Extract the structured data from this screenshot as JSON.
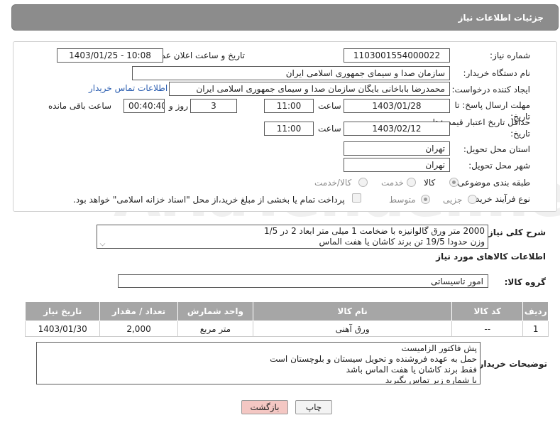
{
  "header": {
    "title": "جزئیات اطلاعات نیاز"
  },
  "form": {
    "need_number_label": "شماره نیاز:",
    "need_number": "1103001554000022",
    "announce_label": "تاریخ و ساعت اعلان عمومی:",
    "announce_value": "1403/01/25 - 10:08",
    "buyer_org_label": "نام دستگاه خریدار:",
    "buyer_org": "سازمان صدا و سیمای جمهوری اسلامی ایران",
    "creator_label": "ایجاد کننده درخواست:",
    "creator": "محمدرضا  باباخانی بایگان سازمان صدا و سیمای جمهوری اسلامی ایران",
    "contact_link": "اطلاعات تماس خریدار",
    "deadline_label": "مهلت ارسال پاسخ: تا تاریخ:",
    "deadline_date": "1403/01/28",
    "time_label": "ساعت",
    "deadline_time": "11:00",
    "days_value": "3",
    "days_label": "روز و",
    "remaining_value": "00:40:40",
    "remaining_label": "ساعت باقی مانده",
    "validity_label": "حداقل تاریخ اعتبار قیمت: تا تاریخ:",
    "validity_date": "1403/02/12",
    "validity_time": "11:00",
    "province_label": "استان محل تحویل:",
    "province": "تهران",
    "city_label": "شهر محل تحویل:",
    "city": "تهران",
    "category_label": "طبقه بندی موضوعی:",
    "category_options": [
      "کالا",
      "خدمت",
      "کالا/خدمت"
    ],
    "process_label": "نوع فرآیند خرید :",
    "process_options": [
      "جزیی",
      "متوسط"
    ],
    "payment_text": "پرداخت تمام یا بخشی از مبلغ خرید،از محل \"اسناد خزانه اسلامی\" خواهد بود."
  },
  "description": {
    "label": "شرح کلی نیاز:",
    "line1": "2000 متر ورق گالوانیزه با ضخامت 1 میلی متر ابعاد 2 در 1/5",
    "line2": "وزن حدودا 19/5 تن برند کاشان یا هفت الماس"
  },
  "goods": {
    "section_title": "اطلاعات کالاهای مورد نیاز",
    "group_label": "گروه کالا:",
    "group_value": "امور تاسیساتی",
    "columns": [
      "ردیف",
      "کد کالا",
      "نام کالا",
      "واحد شمارش",
      "تعداد / مقدار",
      "تاریخ نیاز"
    ],
    "rows": [
      {
        "index": "1",
        "code": "--",
        "name": "ورق آهنی",
        "unit": "متر مربع",
        "qty": "2,000",
        "date": "1403/01/30"
      }
    ]
  },
  "buyer_notes": {
    "label": "توضیحات خریدار:",
    "lines": [
      "پش فاکتور الزامیست",
      "حمل به عهده فروشنده و تحویل سیستان و بلوچستان است",
      "فقط برند کاشان یا هفت الماس باشد",
      "با شماره زیر تماس بگیرید"
    ]
  },
  "buttons": {
    "print": "چاپ",
    "back": "بازگشت"
  },
  "colors": {
    "header_bg": "#8c8c8c",
    "table_header_bg": "#a6a6a6",
    "link": "#2a5db0",
    "back_button_bg": "#f4c7c3"
  }
}
